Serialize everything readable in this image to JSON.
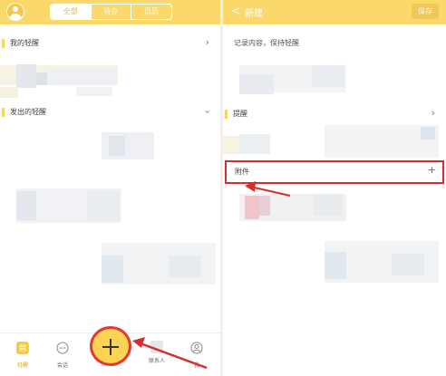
{
  "left": {
    "segments": [
      {
        "label": "全部",
        "active": true
      },
      {
        "label": "待办",
        "active": false
      },
      {
        "label": "日历",
        "active": false
      }
    ],
    "sections": {
      "mine": "我的轻醒",
      "sent": "发出的轻醒"
    },
    "tabbar": [
      {
        "label": "轻醒",
        "icon": "list-icon",
        "active": true
      },
      {
        "label": "会话",
        "icon": "chat-icon",
        "active": false
      },
      {
        "label": "联系人",
        "icon": "contacts-icon",
        "active": false
      },
      {
        "label": "我",
        "icon": "person-icon",
        "active": false
      }
    ],
    "fab_icon": "plus-icon"
  },
  "right": {
    "back_icon": "chevron-left-icon",
    "title": "新建",
    "save": "保存",
    "hint": "记录内容，保持轻醒",
    "remind": "提醒",
    "attachment": "附件"
  },
  "colors": {
    "header": "#fbd86a",
    "accent": "#f0b81c",
    "highlight": "#d32f2f"
  }
}
